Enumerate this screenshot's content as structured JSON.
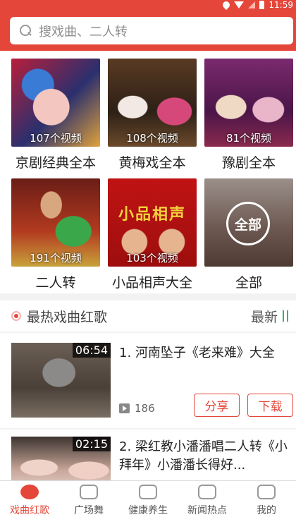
{
  "status_bar": {
    "time": "11:59"
  },
  "search": {
    "placeholder": "搜戏曲、二人转"
  },
  "categories": [
    {
      "label": "京剧经典全本",
      "count": "107个视频"
    },
    {
      "label": "黄梅戏全本",
      "count": "108个视频"
    },
    {
      "label": "豫剧全本",
      "count": "81个视频"
    },
    {
      "label": "二人转",
      "count": "191个视频"
    },
    {
      "label": "小品相声大全",
      "count": "103个视频",
      "poster_text": "小品相声"
    },
    {
      "label": "全部",
      "badge": "全部"
    }
  ],
  "section": {
    "title": "最热戏曲红歌",
    "sort_label": "最新"
  },
  "videos": [
    {
      "duration": "06:54",
      "title": "1. 河南坠子《老来难》大全",
      "plays": "186",
      "share_label": "分享",
      "download_label": "下载"
    },
    {
      "duration": "02:15",
      "title": "2. 梁红教小潘潘唱二人转《小拜年》小潘潘长得好..."
    }
  ],
  "bottom_nav": [
    {
      "label": "戏曲红歌",
      "icon": "opera-icon",
      "active": true
    },
    {
      "label": "广场舞",
      "icon": "dance-icon"
    },
    {
      "label": "健康养生",
      "icon": "bowl-icon"
    },
    {
      "label": "新闻热点",
      "icon": "news-icon"
    },
    {
      "label": "我的",
      "icon": "user-icon"
    }
  ],
  "colors": {
    "brand": "#e4473a",
    "sort_icon": "#35b56b"
  }
}
